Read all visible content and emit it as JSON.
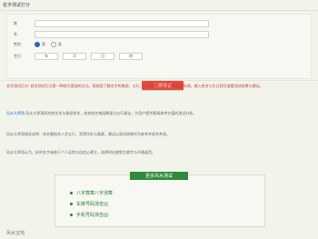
{
  "page": {
    "title": "名字测试打分"
  },
  "form": {
    "fields": {
      "surname_label": "姓",
      "name_label": "名",
      "gender_label": "性别",
      "birth_label": "生日",
      "male": "男",
      "female": "女"
    },
    "submit_label": "立即测试",
    "selects": [
      "年",
      "月",
      "日",
      "时"
    ]
  },
  "content": {
    "p1": "名字测试打分: 姓名测试打分是一种较为直观的方式，帮助您了解名字的笔画、五行、三才配置以及音律等是否协调。输入姓名与生日即可查看测试结果与建议。",
    "p2_highlight": "风水大师哥",
    "p2": "风水大师哥研究姓名学与易经多年，结合姓名笔画数理与五行理论，为用户提供更具参考价值的测试分析。",
    "p3": "风水大师哥相关说明：命名需结合八字五行、音律字形与寓意，建议以测试结果作为参考并综合考虑。",
    "p4": "风水大师哥认为，好的名字有助于个人运势与自信心建立，选择时应避免生僻字与不雅谐音。"
  },
  "links": {
    "tab": "更多风水测试",
    "items": [
      "八字算算八字测算",
      "车牌号码测吉凶",
      "手机号码测吉凶"
    ]
  },
  "footer": {
    "label": "风水宝地"
  }
}
